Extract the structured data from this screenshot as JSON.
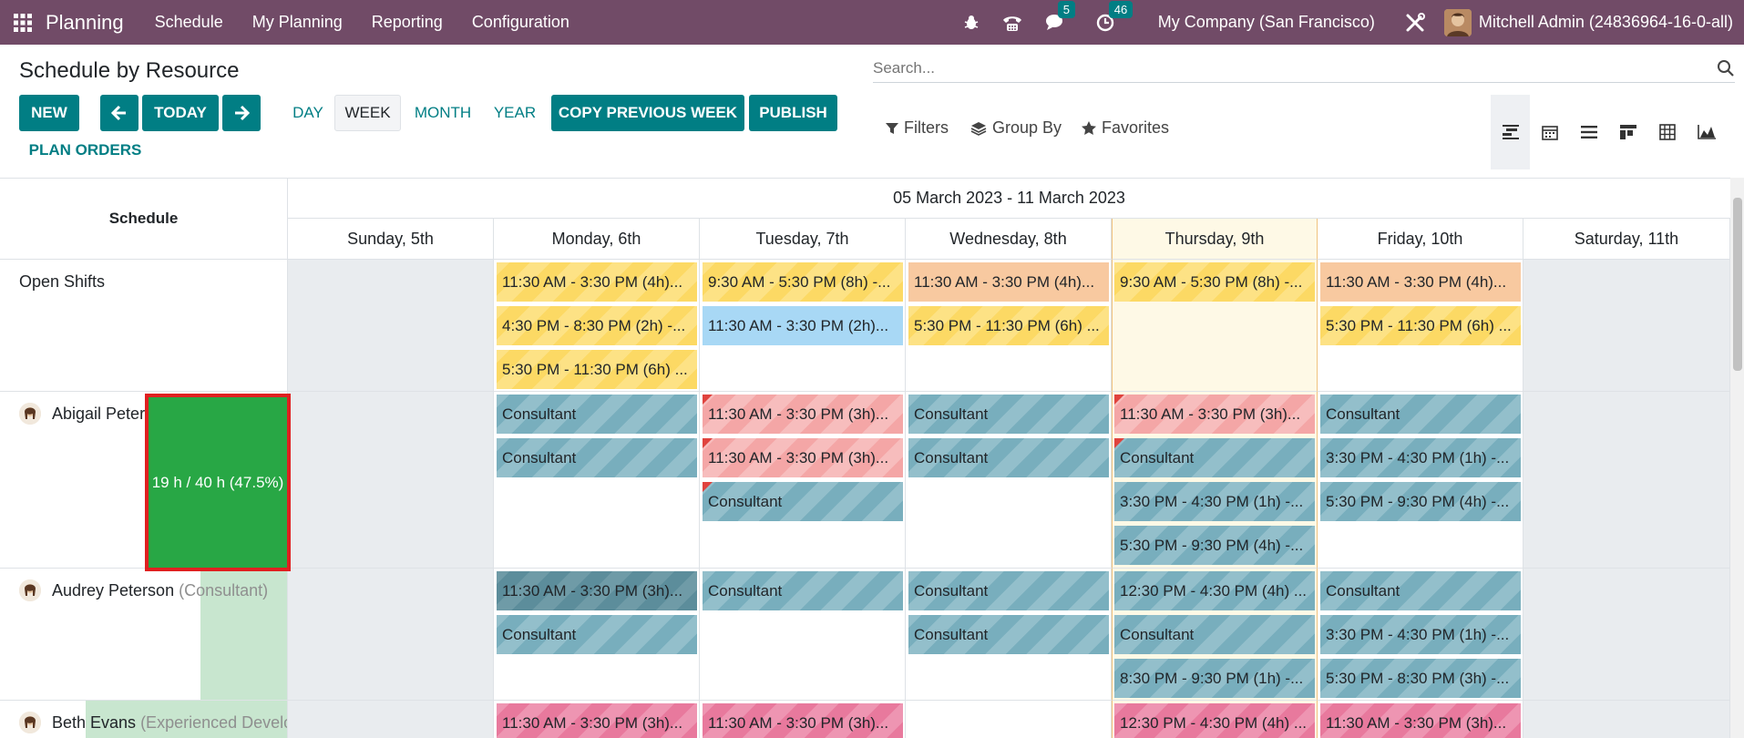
{
  "topbar": {
    "app_name": "Planning",
    "menus": [
      "Schedule",
      "My Planning",
      "Reporting",
      "Configuration"
    ],
    "messages_count": "5",
    "activities_count": "46",
    "company": "My Company (San Francisco)",
    "user": "Mitchell Admin (24836964-16-0-all)"
  },
  "control": {
    "title": "Schedule by Resource",
    "new_label": "NEW",
    "today_label": "TODAY",
    "scales": [
      "DAY",
      "WEEK",
      "MONTH",
      "YEAR"
    ],
    "active_scale": "WEEK",
    "copy_label": "COPY PREVIOUS WEEK",
    "publish_label": "PUBLISH",
    "plan_orders_label": "PLAN ORDERS",
    "search_placeholder": "Search...",
    "filters_label": "Filters",
    "groupby_label": "Group By",
    "favorites_label": "Favorites"
  },
  "grid": {
    "schedule_label": "Schedule",
    "range_label": "05 March 2023 - 11 March 2023",
    "days": [
      "Sunday, 5th",
      "Monday, 6th",
      "Tuesday, 7th",
      "Wednesday, 8th",
      "Thursday, 9th",
      "Friday, 10th",
      "Saturday, 11th"
    ],
    "rows": [
      {
        "name": "Open Shifts",
        "role": "",
        "cells": [
          [],
          [
            {
              "t": "11:30 AM - 3:30 PM (4h)...",
              "c": "yellow"
            },
            {
              "t": "4:30 PM - 8:30 PM (2h) -...",
              "c": "yellow"
            },
            {
              "t": "5:30 PM - 11:30 PM (6h) ...",
              "c": "yellow"
            }
          ],
          [
            {
              "t": "9:30 AM - 5:30 PM (8h) -...",
              "c": "yellow"
            },
            {
              "t": "11:30 AM - 3:30 PM (2h)...",
              "c": "blue"
            }
          ],
          [
            {
              "t": "11:30 AM - 3:30 PM (4h)...",
              "c": "orange"
            },
            {
              "t": "5:30 PM - 11:30 PM (6h) ...",
              "c": "yellow"
            }
          ],
          [
            {
              "t": "9:30 AM - 5:30 PM (8h) -...",
              "c": "yellow"
            }
          ],
          [
            {
              "t": "11:30 AM - 3:30 PM (4h)...",
              "c": "orange"
            },
            {
              "t": "5:30 PM - 11:30 PM (6h) ...",
              "c": "yellow"
            }
          ],
          []
        ]
      },
      {
        "name": "Abigail Peterson",
        "role": "",
        "progress_label": "19 h / 40 h (47.5%)",
        "progress": 0.475,
        "cells": [
          [],
          [
            {
              "t": "Consultant",
              "c": "teal"
            },
            {
              "t": "Consultant",
              "c": "teal"
            }
          ],
          [
            {
              "t": "11:30 AM - 3:30 PM (3h)...",
              "c": "red",
              "f": 1
            },
            {
              "t": "11:30 AM - 3:30 PM (3h)...",
              "c": "red",
              "f": 1
            },
            {
              "t": "Consultant",
              "c": "teal",
              "f": 1
            }
          ],
          [
            {
              "t": "Consultant",
              "c": "teal"
            },
            {
              "t": "Consultant",
              "c": "teal"
            }
          ],
          [
            {
              "t": "11:30 AM - 3:30 PM (3h)...",
              "c": "red",
              "f": 1
            },
            {
              "t": "Consultant",
              "c": "teal",
              "f": 1
            },
            {
              "t": "3:30 PM - 4:30 PM (1h) -...",
              "c": "teal"
            },
            {
              "t": "5:30 PM - 9:30 PM (4h) -...",
              "c": "teal"
            }
          ],
          [
            {
              "t": "Consultant",
              "c": "teal"
            },
            {
              "t": "3:30 PM - 4:30 PM (1h) -...",
              "c": "teal"
            },
            {
              "t": "5:30 PM - 9:30 PM (4h) -...",
              "c": "teal"
            }
          ],
          []
        ]
      },
      {
        "name": "Audrey Peterson",
        "role": "(Consultant)",
        "progress": 0.48,
        "cells": [
          [],
          [
            {
              "t": "11:30 AM - 3:30 PM (3h)...",
              "c": "dteal"
            },
            {
              "t": "Consultant",
              "c": "teal"
            }
          ],
          [
            {
              "t": "Consultant",
              "c": "teal"
            }
          ],
          [
            {
              "t": "Consultant",
              "c": "teal"
            },
            {
              "t": "Consultant",
              "c": "teal"
            }
          ],
          [
            {
              "t": "12:30 PM - 4:30 PM (4h) ...",
              "c": "teal"
            },
            {
              "t": "Consultant",
              "c": "teal"
            },
            {
              "t": "8:30 PM - 9:30 PM (1h) -...",
              "c": "teal"
            }
          ],
          [
            {
              "t": "Consultant",
              "c": "teal"
            },
            {
              "t": "3:30 PM - 4:30 PM (1h) -...",
              "c": "teal"
            },
            {
              "t": "5:30 PM - 8:30 PM (3h) -...",
              "c": "teal"
            }
          ],
          []
        ]
      },
      {
        "name": "Beth Evans",
        "role": "(Experienced Developer)",
        "progress": 0.75,
        "cells": [
          [],
          [
            {
              "t": "11:30 AM - 3:30 PM (3h)...",
              "c": "pink"
            }
          ],
          [
            {
              "t": "11:30 AM - 3:30 PM (3h)...",
              "c": "pink"
            }
          ],
          [],
          [
            {
              "t": "12:30 PM - 4:30 PM (4h) ...",
              "c": "pink"
            }
          ],
          [
            {
              "t": "11:30 AM - 3:30 PM (3h)...",
              "c": "pink"
            }
          ],
          []
        ]
      }
    ]
  }
}
